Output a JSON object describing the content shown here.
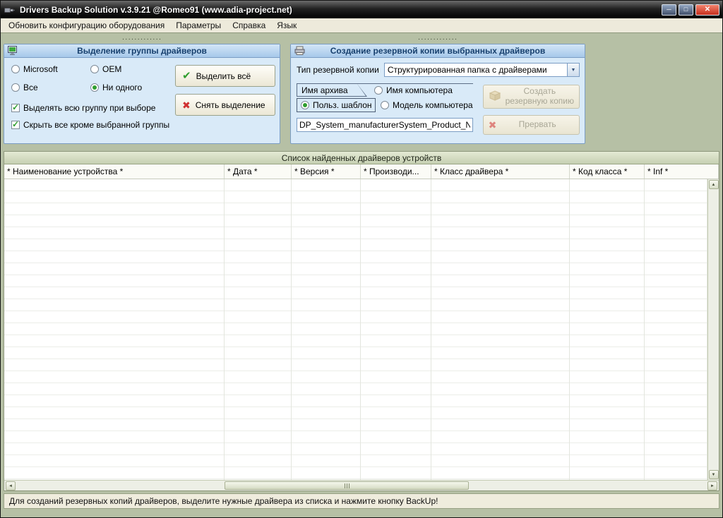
{
  "colors": {
    "content_bg": "#b6c0a5",
    "panel_bg": "#d9eaf8",
    "panel_border": "#7b9dc4",
    "accent_green": "#2f9e2f",
    "accent_red": "#d03030",
    "close_red": "#c62f1d"
  },
  "icons": {
    "minimize": "─",
    "maximize": "□",
    "close": "✕",
    "check": "✔",
    "cross": "✖",
    "dropdown_arrow": "▼",
    "scroll_up": "▲",
    "scroll_down": "▼",
    "scroll_left": "◄",
    "scroll_right": "►",
    "dots_handle": "·············"
  },
  "window": {
    "title": "Drivers Backup Solution v.3.9.21 @Romeo91 (www.adia-project.net)"
  },
  "menu": {
    "items": [
      "Обновить конфигурацию оборудования",
      "Параметры",
      "Справка",
      "Язык"
    ]
  },
  "selection_group": {
    "title": "Выделение группы драйверов",
    "radios": [
      {
        "label": "Microsoft",
        "checked": false
      },
      {
        "label": "OEM",
        "checked": false
      },
      {
        "label": "Все",
        "checked": false
      },
      {
        "label": "Ни одного",
        "checked": true
      }
    ],
    "checkboxes": [
      {
        "label": "Выделять всю группу при выборе",
        "checked": true
      },
      {
        "label": "Скрыть все кроме выбранной группы",
        "checked": true
      }
    ],
    "select_all_label": "Выделить всё",
    "clear_selection_label": "Снять выделение"
  },
  "backup_group": {
    "title": "Создание резервной копии выбранных драйверов",
    "type_label": "Тип резервной копии",
    "type_value": "Структурированная папка с драйверами",
    "archive_tab_label": "Имя архива",
    "radios": [
      {
        "label": "Польз. шаблон",
        "checked": true
      },
      {
        "label": "Имя компьютера",
        "checked": false
      },
      {
        "label": "Модель компьютера",
        "checked": false
      }
    ],
    "template_value": "DP_System_manufacturerSystem_Product_Name",
    "create_label": "Создать резервную копию",
    "abort_label": "Прервать"
  },
  "table": {
    "title": "Список найденных драйверов устройств",
    "columns": [
      "* Наименование устройства *",
      "* Дата *",
      "* Версия *",
      "* Производи...",
      "* Класс драйвера *",
      "* Код класса *",
      "* Inf *"
    ]
  },
  "status_bar": {
    "text": "Для созданий резервных копий драйверов, выделите нужные драйвера из списка и нажмите кнопку BackUp!"
  }
}
